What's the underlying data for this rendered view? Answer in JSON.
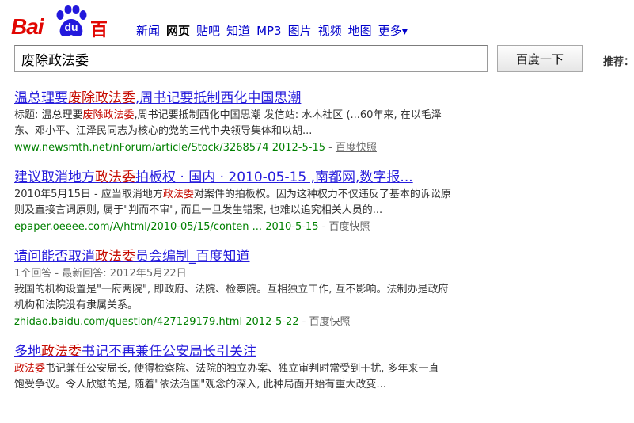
{
  "logo": {
    "left": "Bai",
    "mid": "du",
    "right": "百度"
  },
  "nav": [
    {
      "label": "新闻",
      "active": false
    },
    {
      "label": "网页",
      "active": true
    },
    {
      "label": "贴吧",
      "active": false
    },
    {
      "label": "知道",
      "active": false
    },
    {
      "label": "MP3",
      "active": false
    },
    {
      "label": "图片",
      "active": false
    },
    {
      "label": "视频",
      "active": false
    },
    {
      "label": "地图",
      "active": false
    },
    {
      "label": "更多▾",
      "active": false
    }
  ],
  "search": {
    "value": "废除政法委",
    "button": "百度一下",
    "recommend_label": "推荐："
  },
  "results": [
    {
      "title": [
        {
          "t": "温总理要",
          "hl": false
        },
        {
          "t": "废除政法委",
          "hl": true
        },
        {
          "t": ",周书记要抵制西化中国思潮",
          "hl": false
        }
      ],
      "meta": "",
      "abstract": [
        [
          {
            "t": "标题: 温总理要",
            "hl": false
          },
          {
            "t": "废除政法委",
            "hl": true
          },
          {
            "t": ",周书记要抵制西化中国思潮 发信站: 水木社区 (...60年来, 在以毛泽",
            "hl": false
          }
        ],
        [
          {
            "t": "东、邓小平、江泽民同志为核心的党的三代中央领导集体和以胡...",
            "hl": false
          }
        ]
      ],
      "url": "www.newsmth.net/nForum/article/Stock/3268574 2012-5-15",
      "cache": "百度快照"
    },
    {
      "title": [
        {
          "t": "建议取消地方",
          "hl": false
        },
        {
          "t": "政法委",
          "hl": true
        },
        {
          "t": "拍板权 · 国内 · 2010-05-15 ,南都网,数字报...",
          "hl": false
        }
      ],
      "meta": "",
      "abstract": [
        [
          {
            "t": "2010年5月15日 - 应当取消地方",
            "hl": false
          },
          {
            "t": "政法委",
            "hl": true
          },
          {
            "t": "对案件的拍板权。因为这种权力不仅违反了基本的诉讼原",
            "hl": false
          }
        ],
        [
          {
            "t": "则及直接言词原则, 属于\"判而不审\", 而且一旦发生错案, 也难以追究相关人员的...",
            "hl": false
          }
        ]
      ],
      "url": "epaper.oeeee.com/A/html/2010-05/15/conten ... 2010-5-15",
      "cache": "百度快照"
    },
    {
      "title": [
        {
          "t": "请问能否取消",
          "hl": false
        },
        {
          "t": "政法委",
          "hl": true
        },
        {
          "t": "员会编制_百度知道",
          "hl": false
        }
      ],
      "meta": "1个回答 - 最新回答: 2012年5月22日",
      "abstract": [
        [
          {
            "t": "我国的机构设置是\"一府两院\", 即政府、法院、检察院。互相独立工作, 互不影响。法制办是政府",
            "hl": false
          }
        ],
        [
          {
            "t": "机构和法院没有隶属关系。",
            "hl": false
          }
        ]
      ],
      "url": "zhidao.baidu.com/question/427129179.html 2012-5-22",
      "cache": "百度快照"
    },
    {
      "title": [
        {
          "t": "多地",
          "hl": false
        },
        {
          "t": "政法委",
          "hl": true
        },
        {
          "t": "书记不再兼任公安局长引关注",
          "hl": false
        }
      ],
      "meta": "",
      "abstract": [
        [
          {
            "t": "政法委",
            "hl": true
          },
          {
            "t": "书记兼任公安局长, 使得检察院、法院的独立办案、独立审判时常受到干扰, 多年来一直",
            "hl": false
          }
        ],
        [
          {
            "t": "饱受争议。令人欣慰的是, 随着\"依法治国\"观念的深入, 此种局面开始有重大改变...",
            "hl": false
          }
        ]
      ],
      "url": "",
      "cache": ""
    }
  ]
}
